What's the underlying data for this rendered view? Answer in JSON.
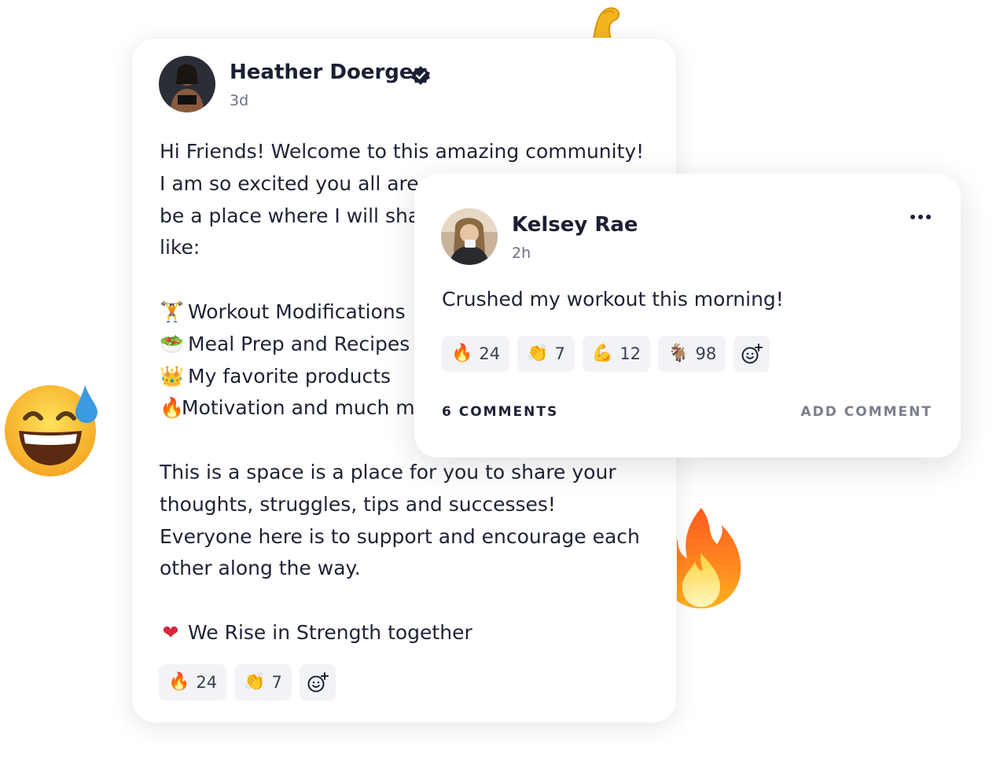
{
  "main_post": {
    "author": "Heather Doerge",
    "time": "3d",
    "lines": [
      "Hi Friends! Welcome to this amazing community!",
      "I am so excited you all are '",
      "be a place where I will sha",
      "like:"
    ],
    "list": [
      {
        "icon": "🏋",
        "text": "Workout Modifications"
      },
      {
        "icon": "🥗",
        "text": "Meal Prep and Recipes"
      },
      {
        "icon": "👑",
        "text": "My favorite products"
      },
      {
        "icon": "🔥",
        "text": "Motivation and much m"
      }
    ],
    "paragraph": [
      "This is a space is a place for you to share your",
      "thoughts, struggles, tips and successes!",
      "Everyone here is to support and encourage each",
      "other along the way."
    ],
    "closing": {
      "icon": "❤",
      "text": "We Rise in Strength together"
    },
    "reactions": [
      {
        "icon": "🔥",
        "count": "24"
      },
      {
        "icon": "👏",
        "count": "7"
      }
    ]
  },
  "comment_post": {
    "author": "Kelsey Rae",
    "time": "2h",
    "text": "Crushed my workout this morning!",
    "reactions": [
      {
        "icon": "🔥",
        "count": "24"
      },
      {
        "icon": "👏",
        "count": "7"
      },
      {
        "icon": "💪",
        "count": "12"
      },
      {
        "icon": "🐐",
        "count": "98"
      }
    ],
    "comments_label": "6 COMMENTS",
    "add_comment_label": "ADD COMMENT"
  },
  "colors": {
    "text": "#1e2235",
    "muted": "#6b7082",
    "chip_bg": "#f2f3f6",
    "link_muted": "#7a7e8c"
  },
  "icons": {
    "verified": "verified-badge-icon",
    "add_reaction": "add-reaction-icon",
    "more": "more-options-icon"
  }
}
